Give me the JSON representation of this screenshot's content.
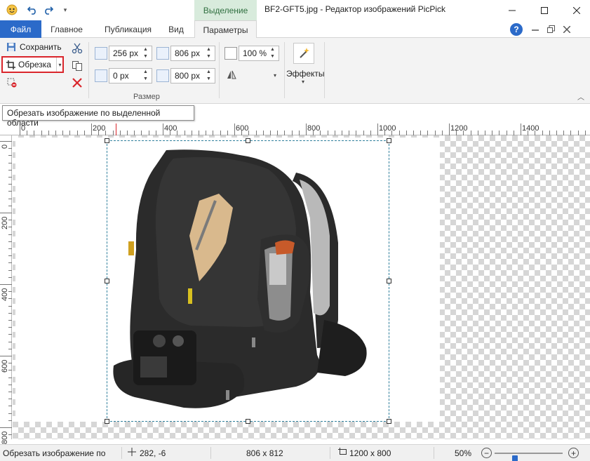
{
  "titlebar": {
    "context_tab": "Выделение",
    "title": "BF2-GFT5.jpg - Редактор изображений PicPick",
    "minimize_icon": "minimize-icon",
    "maximize_icon": "maximize-icon",
    "close_icon": "close-icon"
  },
  "tabs": [
    {
      "label": "Файл"
    },
    {
      "label": "Главное"
    },
    {
      "label": "Публикация"
    },
    {
      "label": "Вид"
    },
    {
      "label": "Параметры"
    }
  ],
  "ribbon": {
    "save_label": "Сохранить",
    "crop_label": "Обрезка",
    "group_label": "Размер",
    "left_value": "256 px",
    "width_value": "806 px",
    "top_value": "0 px",
    "height_value": "800 px",
    "percent_value": "100 %",
    "effects_label": "Эффекты"
  },
  "tooltip": "Обрезать изображение по выделенной области",
  "hruler_labels": [
    "0",
    "200",
    "400",
    "600",
    "800",
    "1000",
    "1200",
    "1400",
    "160"
  ],
  "vruler_labels": [
    "0",
    "200",
    "400",
    "600",
    "800"
  ],
  "status": {
    "message": "Обрезать изображение по",
    "cursor_pos": "282, -6",
    "selection_size": "806 x 812",
    "image_size": "1200 x 800",
    "zoom": "50%",
    "zoom_level": 0.3
  },
  "colors": {
    "file_tab": "#2b6ac9",
    "context_tab_bg": "#d8ebdc",
    "crop_highlight": "#d9252b"
  }
}
